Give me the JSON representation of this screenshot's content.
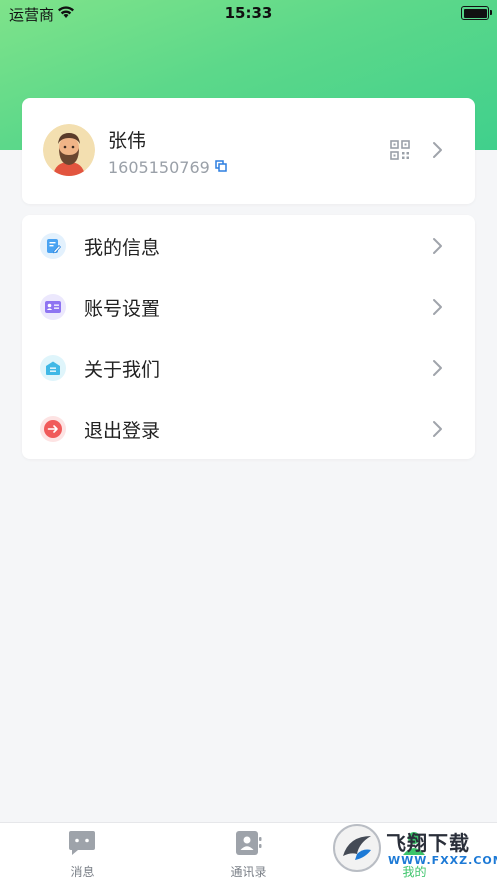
{
  "status_bar": {
    "carrier": "运营商",
    "time": "15:33"
  },
  "profile": {
    "name": "张伟",
    "id": "1605150769"
  },
  "menu": {
    "items": [
      {
        "label": "我的信息",
        "icon": "edit-profile-icon"
      },
      {
        "label": "账号设置",
        "icon": "id-card-icon"
      },
      {
        "label": "关于我们",
        "icon": "about-icon"
      },
      {
        "label": "退出登录",
        "icon": "logout-icon"
      }
    ]
  },
  "tabs": [
    {
      "label": "消息",
      "icon": "chat-bubble-icon"
    },
    {
      "label": "通讯录",
      "icon": "contacts-icon"
    },
    {
      "label": "我的",
      "icon": "profile-icon",
      "active": true
    }
  ],
  "watermark": {
    "title": "飞翔下载",
    "url": "WWW.FXXZ.COM"
  },
  "colors": {
    "accent": "#3cc46a",
    "header_start": "#7fe38a",
    "header_end": "#40d08c"
  }
}
